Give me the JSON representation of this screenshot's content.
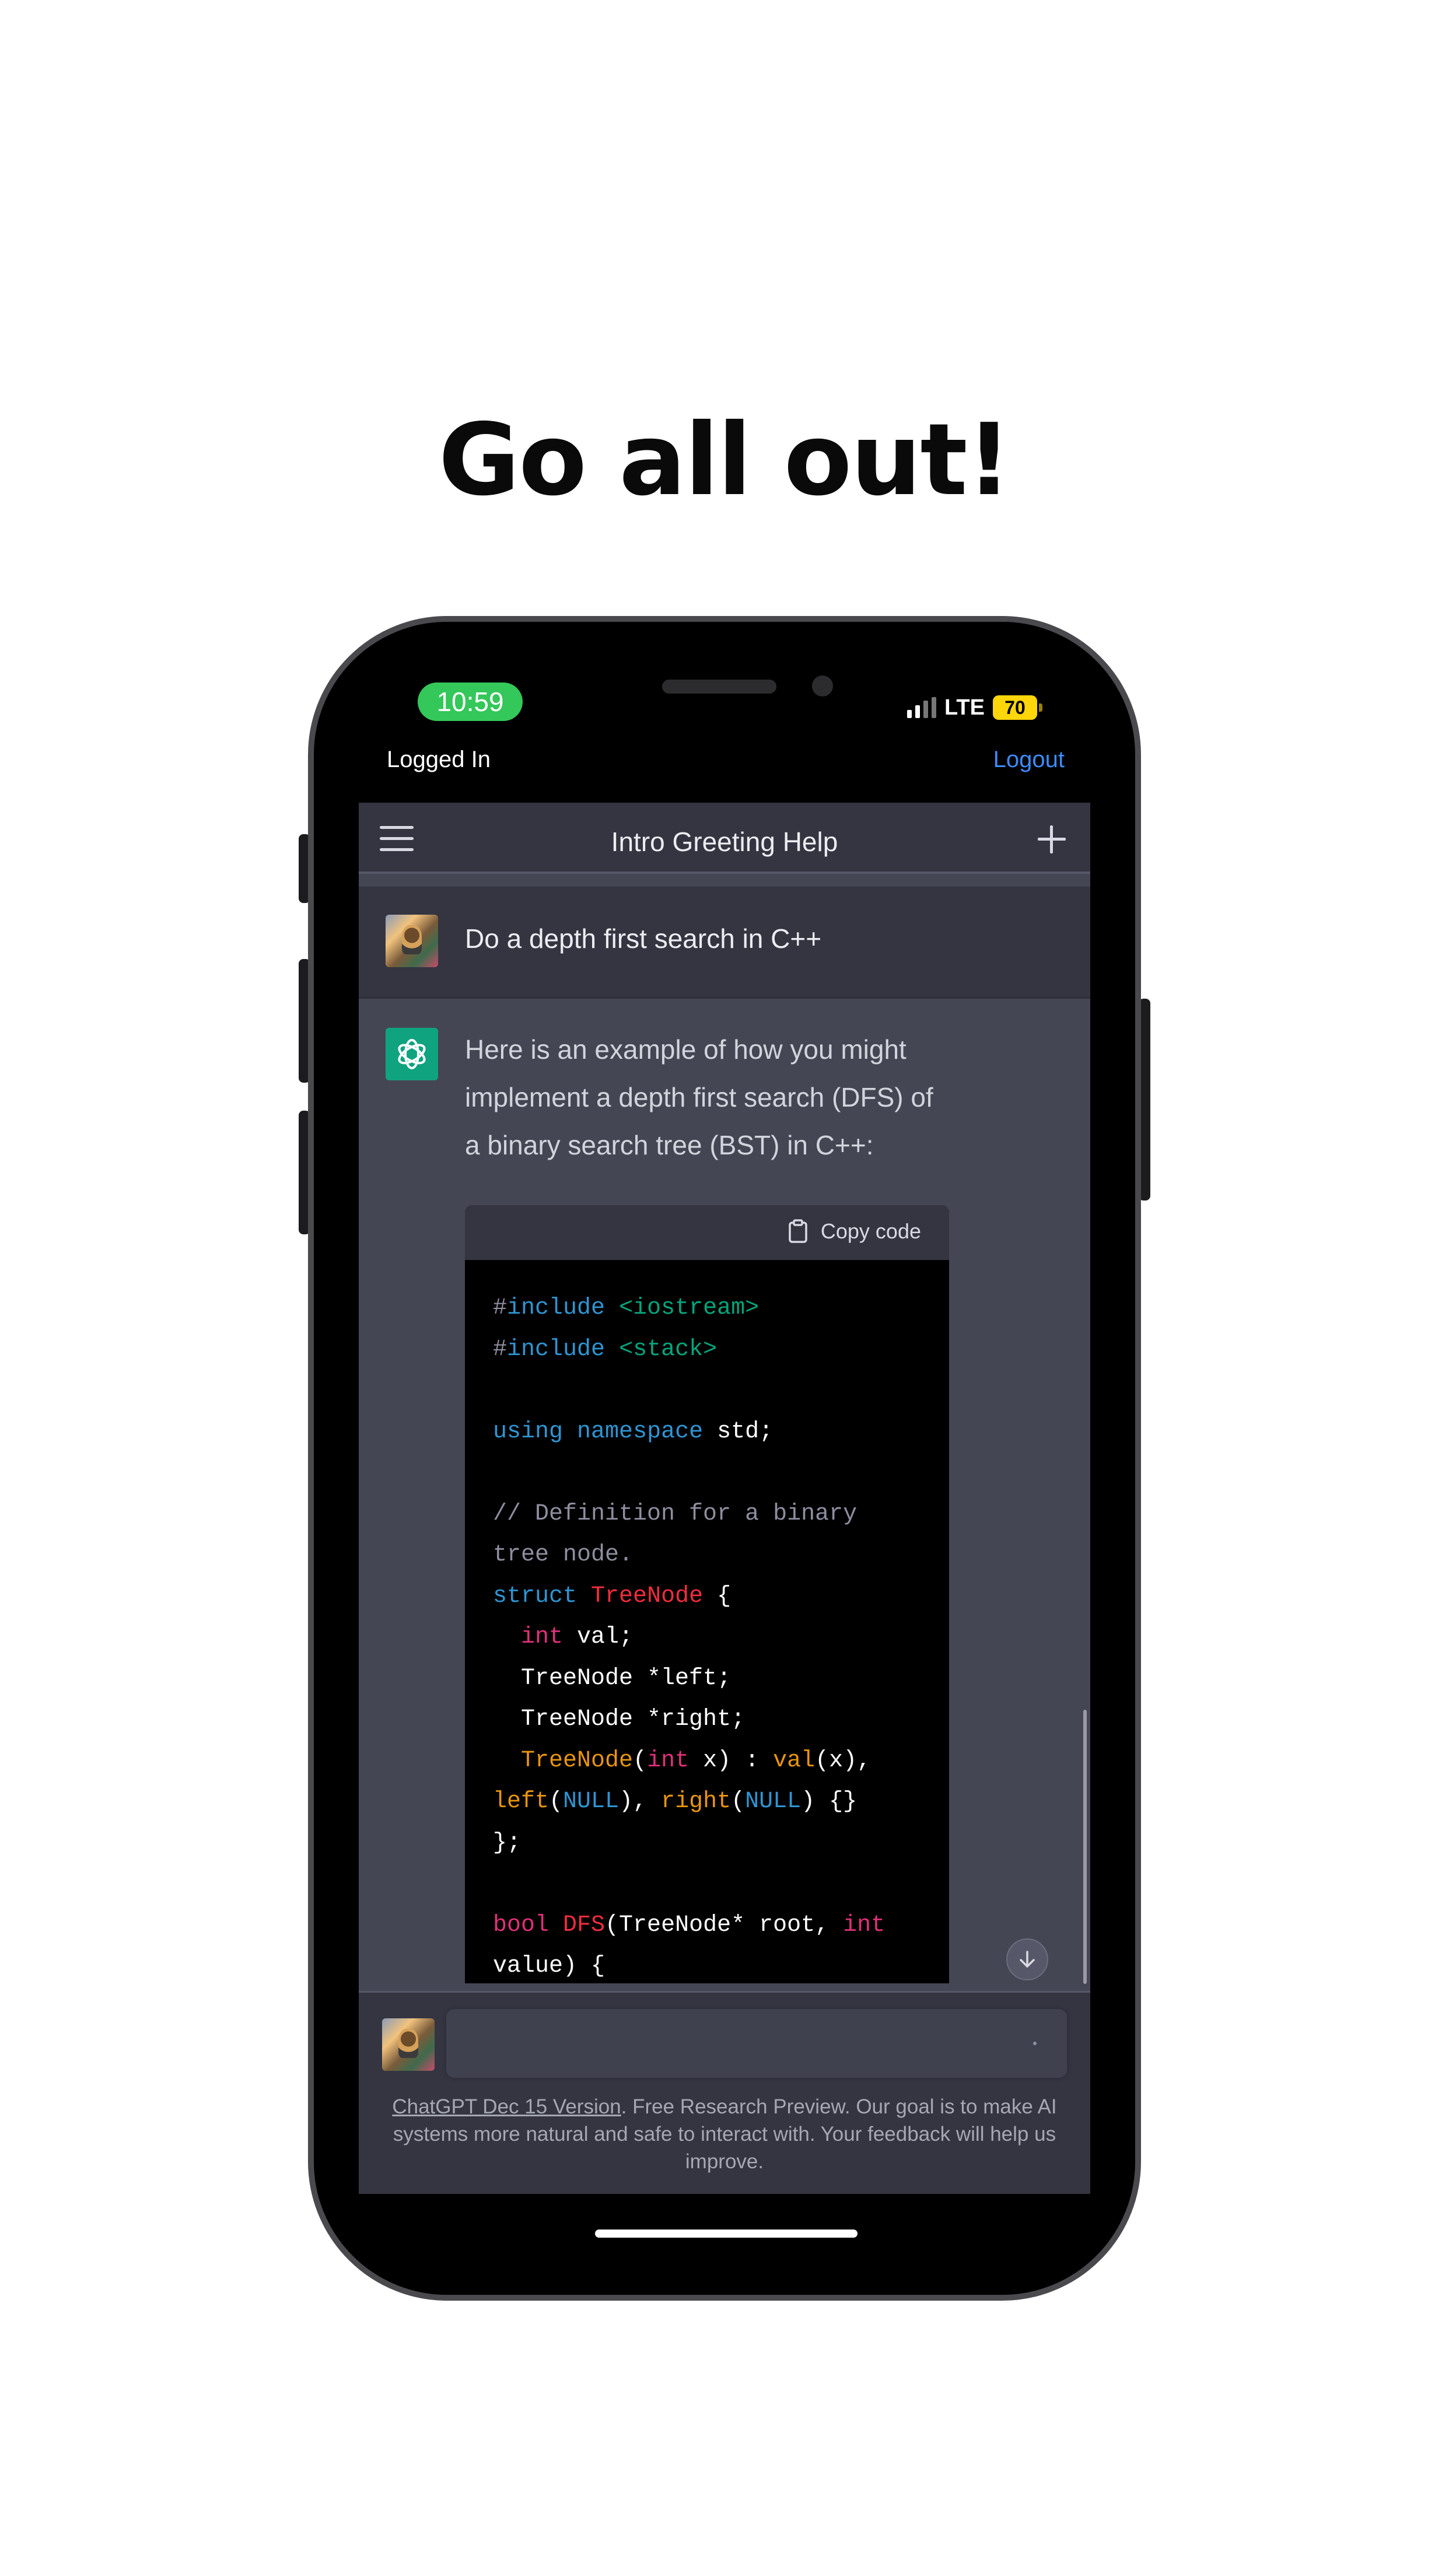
{
  "headline": "Go all out!",
  "status_bar": {
    "time": "10:59",
    "network": "LTE",
    "battery": "70"
  },
  "top_bar": {
    "status_label": "Logged In",
    "logout_label": "Logout"
  },
  "nav": {
    "title": "Intro Greeting Help",
    "menu_icon": "hamburger-menu-icon",
    "new_chat_icon": "plus-icon"
  },
  "user_message": {
    "text": "Do a depth first search in C++"
  },
  "assistant_message": {
    "text": "Here is an example of how you might implement a depth first search (DFS) of a binary search tree (BST) in C++:",
    "code_block": {
      "copy_label": "Copy code",
      "lines": [
        "#include <iostream>",
        "#include <stack>",
        "",
        "using namespace std;",
        "",
        "// Definition for a binary",
        "tree node.",
        "struct TreeNode {",
        "  int val;",
        "  TreeNode *left;",
        "  TreeNode *right;",
        "  TreeNode(int x) : val(x),",
        "left(NULL), right(NULL) {}",
        "};",
        "",
        "bool DFS(TreeNode* root, int",
        "value) {"
      ]
    }
  },
  "composer": {
    "input_value": "",
    "footer_link": "ChatGPT Dec 15 Version",
    "footer_text": ". Free Research Preview. Our goal is to make AI systems more natural and safe to interact with. Your feedback will help us improve."
  },
  "colors": {
    "assistant_logo_bg": "#10a37f",
    "link": "#3d8bfd",
    "clock_pill": "#34c759",
    "battery": "#ffd60a"
  }
}
